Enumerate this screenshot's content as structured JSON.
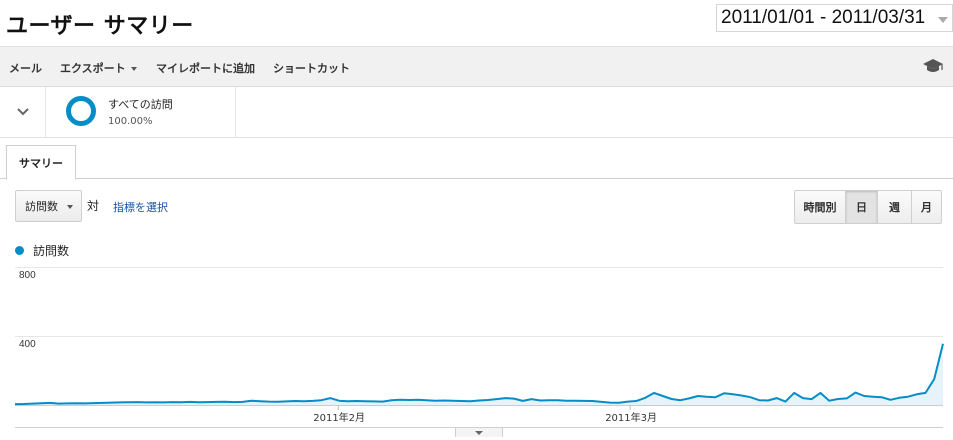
{
  "header": {
    "title": "ユーザー サマリー",
    "date_range": "2011/01/01 - 2011/03/31"
  },
  "toolbar": {
    "email": "メール",
    "export": "エクスポート",
    "add_to_dashboard": "マイレポートに追加",
    "shortcut": "ショートカット"
  },
  "segment": {
    "name": "すべての訪問",
    "percent": "100.00%",
    "color": "#058dc7"
  },
  "tabs": {
    "summary": "サマリー"
  },
  "controls": {
    "metric": "訪問数",
    "vs": "対",
    "select_metric": "指標を選択",
    "granularity": [
      {
        "label": "時間別",
        "active": false
      },
      {
        "label": "日",
        "active": true
      },
      {
        "label": "週",
        "active": false
      },
      {
        "label": "月",
        "active": false
      }
    ]
  },
  "legend": {
    "label": "訪問数",
    "color": "#058dc7"
  },
  "chart_data": {
    "type": "area",
    "series": [
      {
        "name": "訪問数",
        "color": "#058dc7",
        "values": [
          5,
          6,
          8,
          10,
          12,
          8,
          9,
          10,
          9,
          11,
          12,
          14,
          15,
          16,
          17,
          15,
          16,
          15,
          17,
          16,
          18,
          16,
          17,
          18,
          19,
          17,
          18,
          25,
          22,
          20,
          19,
          21,
          23,
          22,
          24,
          28,
          40,
          25,
          22,
          23,
          22,
          21,
          20,
          28,
          31,
          29,
          30,
          27,
          25,
          26,
          25,
          23,
          22,
          26,
          29,
          34,
          40,
          37,
          24,
          34,
          26,
          28,
          27,
          25,
          25,
          24,
          23,
          18,
          14,
          13,
          20,
          24,
          42,
          70,
          52,
          35,
          28,
          38,
          52,
          48,
          45,
          68,
          62,
          55,
          45,
          28,
          26,
          40,
          20,
          70,
          40,
          34,
          70,
          25,
          35,
          38,
          72,
          52,
          48,
          45,
          30,
          42,
          48,
          62,
          70,
          150,
          355
        ]
      }
    ],
    "y_ticks": [
      "800",
      "400"
    ],
    "x_ticks": [
      "2011年2月",
      "2011年3月"
    ],
    "ylim": [
      0,
      800
    ]
  }
}
